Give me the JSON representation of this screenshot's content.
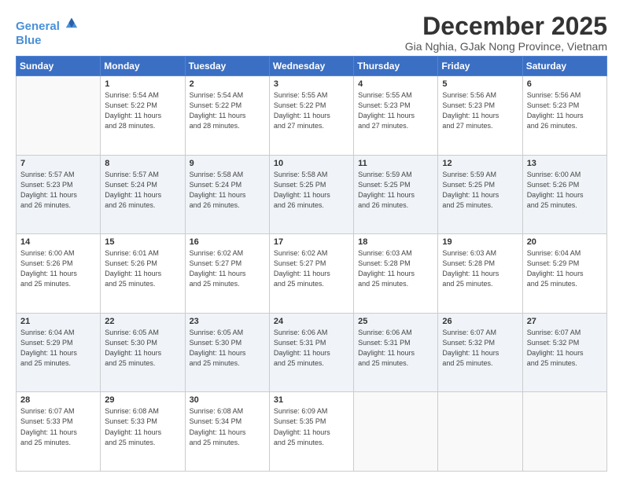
{
  "logo": {
    "line1": "General",
    "line2": "Blue"
  },
  "title": "December 2025",
  "subtitle": "Gia Nghia, GJak Nong Province, Vietnam",
  "weekdays": [
    "Sunday",
    "Monday",
    "Tuesday",
    "Wednesday",
    "Thursday",
    "Friday",
    "Saturday"
  ],
  "weeks": [
    [
      {
        "day": "",
        "info": ""
      },
      {
        "day": "1",
        "info": "Sunrise: 5:54 AM\nSunset: 5:22 PM\nDaylight: 11 hours\nand 28 minutes."
      },
      {
        "day": "2",
        "info": "Sunrise: 5:54 AM\nSunset: 5:22 PM\nDaylight: 11 hours\nand 28 minutes."
      },
      {
        "day": "3",
        "info": "Sunrise: 5:55 AM\nSunset: 5:22 PM\nDaylight: 11 hours\nand 27 minutes."
      },
      {
        "day": "4",
        "info": "Sunrise: 5:55 AM\nSunset: 5:23 PM\nDaylight: 11 hours\nand 27 minutes."
      },
      {
        "day": "5",
        "info": "Sunrise: 5:56 AM\nSunset: 5:23 PM\nDaylight: 11 hours\nand 27 minutes."
      },
      {
        "day": "6",
        "info": "Sunrise: 5:56 AM\nSunset: 5:23 PM\nDaylight: 11 hours\nand 26 minutes."
      }
    ],
    [
      {
        "day": "7",
        "info": "Sunrise: 5:57 AM\nSunset: 5:23 PM\nDaylight: 11 hours\nand 26 minutes."
      },
      {
        "day": "8",
        "info": "Sunrise: 5:57 AM\nSunset: 5:24 PM\nDaylight: 11 hours\nand 26 minutes."
      },
      {
        "day": "9",
        "info": "Sunrise: 5:58 AM\nSunset: 5:24 PM\nDaylight: 11 hours\nand 26 minutes."
      },
      {
        "day": "10",
        "info": "Sunrise: 5:58 AM\nSunset: 5:25 PM\nDaylight: 11 hours\nand 26 minutes."
      },
      {
        "day": "11",
        "info": "Sunrise: 5:59 AM\nSunset: 5:25 PM\nDaylight: 11 hours\nand 26 minutes."
      },
      {
        "day": "12",
        "info": "Sunrise: 5:59 AM\nSunset: 5:25 PM\nDaylight: 11 hours\nand 25 minutes."
      },
      {
        "day": "13",
        "info": "Sunrise: 6:00 AM\nSunset: 5:26 PM\nDaylight: 11 hours\nand 25 minutes."
      }
    ],
    [
      {
        "day": "14",
        "info": "Sunrise: 6:00 AM\nSunset: 5:26 PM\nDaylight: 11 hours\nand 25 minutes."
      },
      {
        "day": "15",
        "info": "Sunrise: 6:01 AM\nSunset: 5:26 PM\nDaylight: 11 hours\nand 25 minutes."
      },
      {
        "day": "16",
        "info": "Sunrise: 6:02 AM\nSunset: 5:27 PM\nDaylight: 11 hours\nand 25 minutes."
      },
      {
        "day": "17",
        "info": "Sunrise: 6:02 AM\nSunset: 5:27 PM\nDaylight: 11 hours\nand 25 minutes."
      },
      {
        "day": "18",
        "info": "Sunrise: 6:03 AM\nSunset: 5:28 PM\nDaylight: 11 hours\nand 25 minutes."
      },
      {
        "day": "19",
        "info": "Sunrise: 6:03 AM\nSunset: 5:28 PM\nDaylight: 11 hours\nand 25 minutes."
      },
      {
        "day": "20",
        "info": "Sunrise: 6:04 AM\nSunset: 5:29 PM\nDaylight: 11 hours\nand 25 minutes."
      }
    ],
    [
      {
        "day": "21",
        "info": "Sunrise: 6:04 AM\nSunset: 5:29 PM\nDaylight: 11 hours\nand 25 minutes."
      },
      {
        "day": "22",
        "info": "Sunrise: 6:05 AM\nSunset: 5:30 PM\nDaylight: 11 hours\nand 25 minutes."
      },
      {
        "day": "23",
        "info": "Sunrise: 6:05 AM\nSunset: 5:30 PM\nDaylight: 11 hours\nand 25 minutes."
      },
      {
        "day": "24",
        "info": "Sunrise: 6:06 AM\nSunset: 5:31 PM\nDaylight: 11 hours\nand 25 minutes."
      },
      {
        "day": "25",
        "info": "Sunrise: 6:06 AM\nSunset: 5:31 PM\nDaylight: 11 hours\nand 25 minutes."
      },
      {
        "day": "26",
        "info": "Sunrise: 6:07 AM\nSunset: 5:32 PM\nDaylight: 11 hours\nand 25 minutes."
      },
      {
        "day": "27",
        "info": "Sunrise: 6:07 AM\nSunset: 5:32 PM\nDaylight: 11 hours\nand 25 minutes."
      }
    ],
    [
      {
        "day": "28",
        "info": "Sunrise: 6:07 AM\nSunset: 5:33 PM\nDaylight: 11 hours\nand 25 minutes."
      },
      {
        "day": "29",
        "info": "Sunrise: 6:08 AM\nSunset: 5:33 PM\nDaylight: 11 hours\nand 25 minutes."
      },
      {
        "day": "30",
        "info": "Sunrise: 6:08 AM\nSunset: 5:34 PM\nDaylight: 11 hours\nand 25 minutes."
      },
      {
        "day": "31",
        "info": "Sunrise: 6:09 AM\nSunset: 5:35 PM\nDaylight: 11 hours\nand 25 minutes."
      },
      {
        "day": "",
        "info": ""
      },
      {
        "day": "",
        "info": ""
      },
      {
        "day": "",
        "info": ""
      }
    ]
  ]
}
